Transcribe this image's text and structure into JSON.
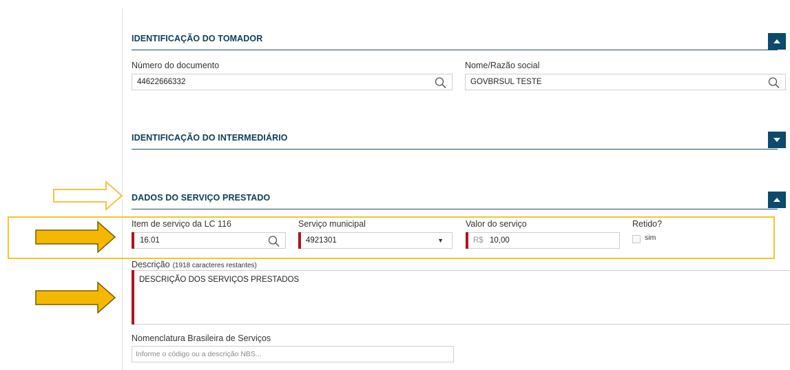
{
  "tomador": {
    "title": "IDENTIFICAÇÃO DO TOMADOR",
    "doc_label": "Número do documento",
    "doc_value": "44622666332",
    "name_label": "Nome/Razão social",
    "name_value": "GOVBRSUL TESTE"
  },
  "intermediario": {
    "title": "IDENTIFICAÇÃO DO INTERMEDIÁRIO"
  },
  "servico": {
    "title": "DADOS DO SERVIÇO PRESTADO",
    "item_label": "Item de serviço da LC 116",
    "item_value": "16.01",
    "municipal_label": "Serviço municipal",
    "municipal_value": "4921301",
    "valor_label": "Valor do serviço",
    "valor_prefix": "R$",
    "valor_value": "10,00",
    "retido_label": "Retido?",
    "retido_option": "sim",
    "retido_checked": false,
    "descricao_label": "Descrição",
    "descricao_remaining": "(1918 caracteres restantes)",
    "descricao_value": "DESCRIÇÃO DOS SERVIÇOS PRESTADOS",
    "nbs_label": "Nomenclatura Brasileira de Serviços",
    "nbs_placeholder": "Informe o código ou a descrição NBS..."
  },
  "colors": {
    "section_title": "#0c3e5a",
    "toggle_bg": "#0b4a6e",
    "required_marker": "#b01220",
    "annotation_arrow": "#f5b800",
    "annotation_box": "#f4c430"
  },
  "icons": {
    "search": "magnifier-icon",
    "collapse": "chevron-up-icon",
    "expand": "chevron-down-icon",
    "dropdown": "caret-down-icon",
    "annotation": "arrow-right-icon"
  }
}
